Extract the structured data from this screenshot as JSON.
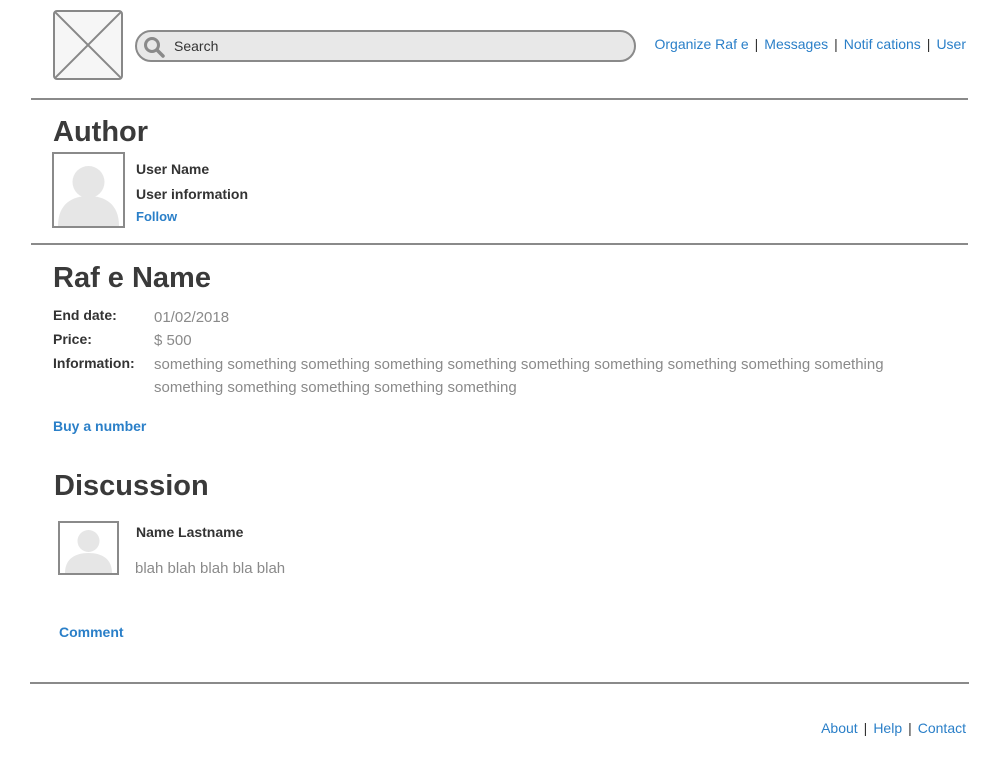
{
  "header": {
    "logo_icon": "image-placeholder-icon",
    "search_placeholder": "Search",
    "nav": [
      "Organize Raf  e",
      "Messages",
      "Notif cations",
      "User"
    ],
    "separator": "|"
  },
  "author": {
    "heading": "Author",
    "user_name": "User Name",
    "user_info": "User information",
    "follow": "Follow"
  },
  "raffle": {
    "title": "Raf  e Name",
    "end_date_label": "End date:",
    "end_date": "01/02/2018",
    "price_label": "Price:",
    "price": "$ 500",
    "info_label": "Information:",
    "info": "something something something something something something something something something something something something something something something",
    "buy": "Buy a number"
  },
  "discussion": {
    "heading": "Discussion",
    "comments": [
      {
        "name": "Name Lastname",
        "text": "blah blah blah bla blah"
      }
    ],
    "comment_link": "Comment"
  },
  "footer": {
    "links": [
      "About",
      "Help",
      "Contact"
    ],
    "separator": "|"
  },
  "colors": {
    "link": "#2a7fc8",
    "text": "#333333",
    "muted": "#8a8a8a",
    "rule": "#8a8a8a"
  }
}
